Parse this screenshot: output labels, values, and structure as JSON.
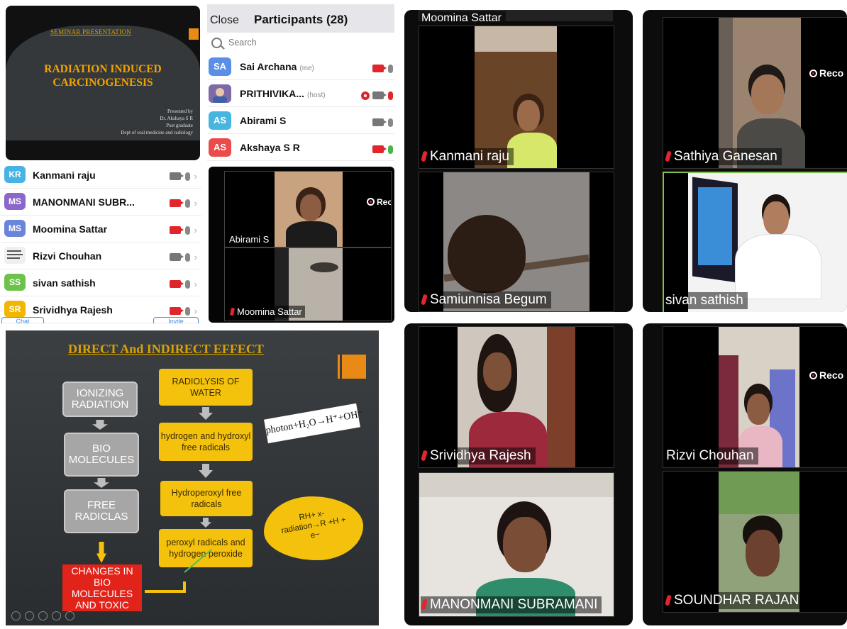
{
  "slide1": {
    "heading": "SEMINAR PRESENTATION",
    "title_line1": "RADIATION INDUCED",
    "title_line2": "CARCINOGENESIS",
    "presenter": [
      "Presented by",
      "Dr. Akshaya S R",
      "Post graduate",
      "Dept of oral medicine and radiology"
    ]
  },
  "participants_panel": {
    "close_label": "Close",
    "title": "Participants (28)",
    "search_placeholder": "Search",
    "rows": [
      {
        "initials": "SA",
        "name": "Sai Archana",
        "tag": "(me)",
        "color": "#5b8ee6"
      },
      {
        "initials": "",
        "name": "PRITHIVIKA...",
        "tag": "(host)",
        "color": "#8a6bbf"
      },
      {
        "initials": "AS",
        "name": "Abirami S",
        "tag": "",
        "color": "#46b6e0"
      },
      {
        "initials": "AS",
        "name": "Akshaya S R",
        "tag": "",
        "color": "#ea4b4b"
      }
    ]
  },
  "participant_list": {
    "rows": [
      {
        "initials": "KR",
        "name": "Kanmani raju",
        "color": "#47b2e4"
      },
      {
        "initials": "MS",
        "name": "MANONMANI SUBR...",
        "color": "#8b67c9"
      },
      {
        "initials": "MS",
        "name": "Moomina Sattar",
        "color": "#6a86d8"
      },
      {
        "initials": "",
        "name": "Rizvi Chouhan",
        "color": "#cfcfcf"
      },
      {
        "initials": "SS",
        "name": "sivan sathish",
        "color": "#6cc24a"
      },
      {
        "initials": "SR",
        "name": "Srividhya Rajesh",
        "color": "#f2b600"
      }
    ],
    "left_button": "Chat",
    "right_button": "Invite"
  },
  "small_video": {
    "recording_label": "Recording",
    "tile1_name": "Abirami S",
    "tile2_name": "Moomina Sattar"
  },
  "grid_top_center": {
    "top_strip_name": "Moomina Sattar",
    "tile1_name": "Kanmani raju",
    "tile2_name": "Samiunnisa Begum"
  },
  "grid_top_right": {
    "recording_label": "Reco",
    "tile1_name": "Sathiya Ganesan",
    "tile2_name": "sivan sathish"
  },
  "grid_bottom_center": {
    "tile1_name": "Srividhya Rajesh",
    "tile2_name": "MANONMANI SUBRAMANI"
  },
  "grid_bottom_right": {
    "recording_label": "Reco",
    "tile1_name": "Rizvi Chouhan",
    "tile2_name": "SOUNDHAR RAJAN"
  },
  "slide2": {
    "title": "DIRECT And INDIRECT EFFECT",
    "left_boxes": [
      "IONIZING RADIATION",
      "BIO MOLECULES",
      "FREE RADICLAS"
    ],
    "result_box": "CHANGES IN BIO MOLECULES AND TOXIC",
    "right_boxes": [
      "RADIOLYSIS OF WATER",
      "hydrogen and hydroxyl free radicals",
      "Hydroperoxyl free radicals",
      "peroxyl radicals and hydrogen peroxide"
    ],
    "equation": "photon+H₂O→H⁺+OH⁻",
    "cloud_text": "RH+ x-radiation→R +H + e−"
  }
}
